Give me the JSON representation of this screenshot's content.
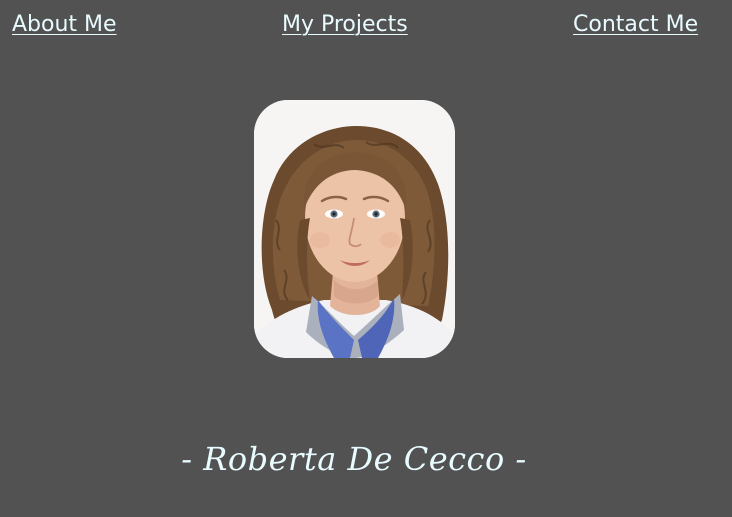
{
  "nav": {
    "about_label": "About Me",
    "projects_label": "My Projects",
    "contact_label": "Contact Me"
  },
  "profile": {
    "name_caption": "- Roberta De Cecco -"
  },
  "colors": {
    "background": "#525252",
    "link_text": "#e8fbff",
    "caption_text": "#e8fbff"
  }
}
